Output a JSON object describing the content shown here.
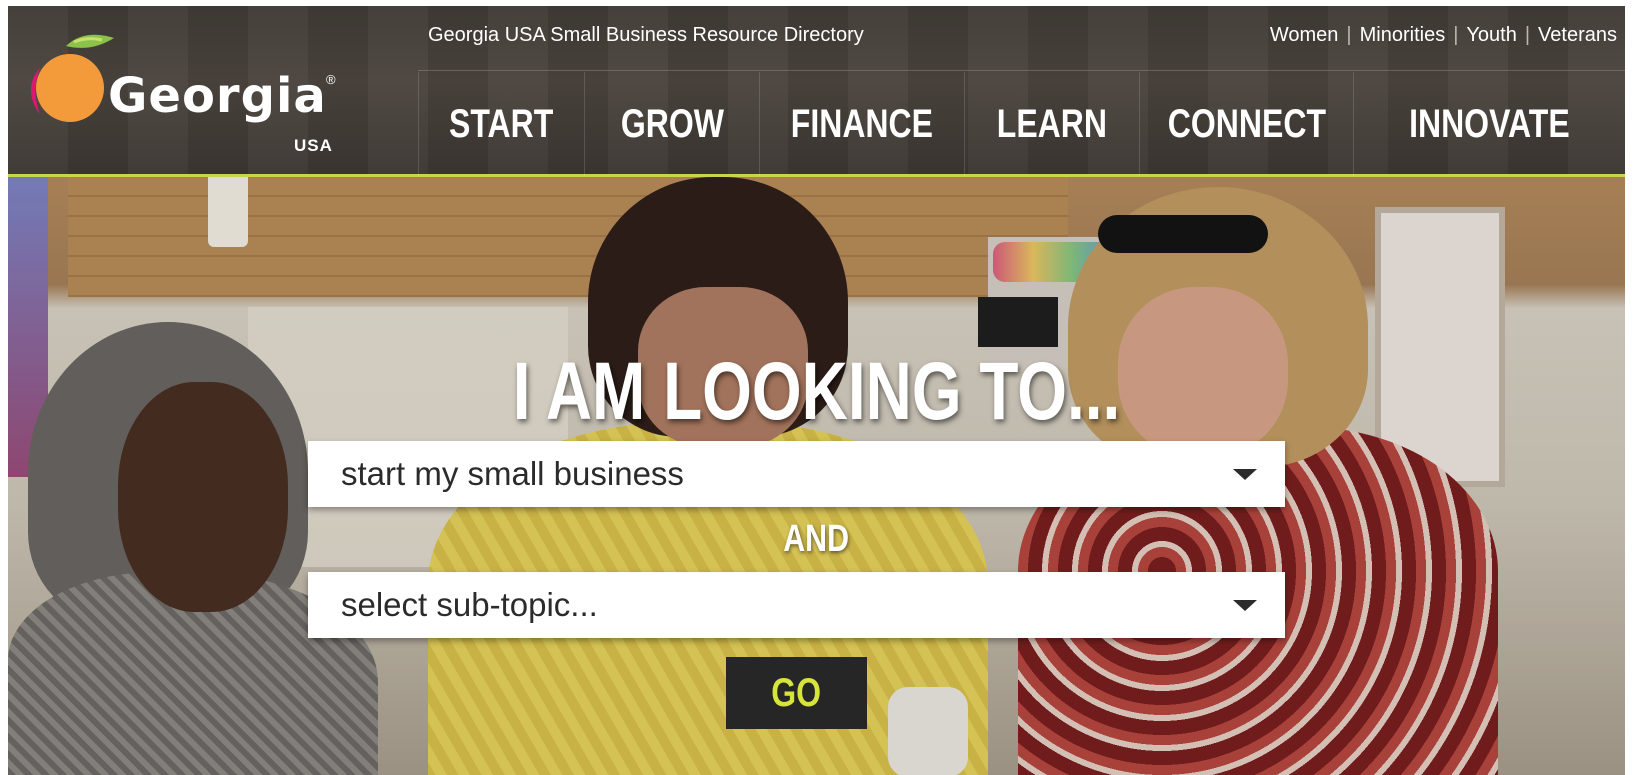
{
  "header": {
    "logo": {
      "name": "Georgia",
      "sub": "USA",
      "reg": "®"
    },
    "site_title": "Georgia USA Small Business Resource Directory",
    "audience_links": [
      "Women",
      "Minorities",
      "Youth",
      "Veterans"
    ],
    "nav": [
      "START",
      "GROW",
      "FINANCE",
      "LEARN",
      "CONNECT",
      "INNOVATE"
    ]
  },
  "hero": {
    "heading": "I AM LOOKING TO...",
    "topic_select": {
      "value": "start my small business"
    },
    "connector": "AND",
    "subtopic_select": {
      "value": "select sub-topic..."
    },
    "go_label": "GO"
  },
  "colors": {
    "accent_green": "#c8d64a",
    "go_text": "#d7e43a",
    "header_bg": "#3f3a35"
  }
}
